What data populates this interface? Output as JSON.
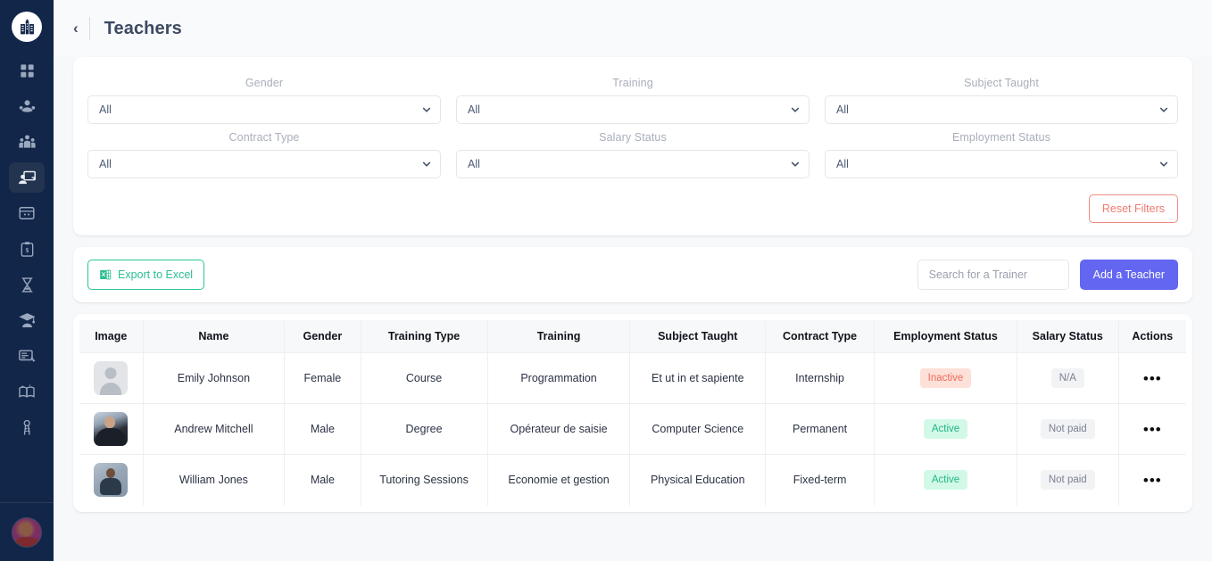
{
  "sidebar": {
    "logo": {
      "name": "school-building-logo"
    },
    "items": [
      {
        "icon": "dashboard-grid-icon",
        "name": "dashboard",
        "active": false
      },
      {
        "icon": "students-icon",
        "name": "students",
        "active": false
      },
      {
        "icon": "parents-group-icon",
        "name": "parents",
        "active": false
      },
      {
        "icon": "teacher-board-icon",
        "name": "teachers",
        "active": true
      },
      {
        "icon": "classroom-window-icon",
        "name": "classes",
        "active": false
      },
      {
        "icon": "clipboard-dollar-icon",
        "name": "payments",
        "active": false
      },
      {
        "icon": "hourglass-icon",
        "name": "schedule",
        "active": false
      },
      {
        "icon": "graduation-cap-icon",
        "name": "graduates",
        "active": false
      },
      {
        "icon": "certificate-icon",
        "name": "certificates",
        "active": false
      },
      {
        "icon": "open-book-icon",
        "name": "library",
        "active": false
      },
      {
        "icon": "keys-icon",
        "name": "access",
        "active": false
      }
    ],
    "footer": {
      "avatar_name": "user-avatar"
    }
  },
  "header": {
    "back_label": "‹",
    "title": "Teachers"
  },
  "filters": {
    "fields": [
      {
        "label": "Gender",
        "value": "All",
        "name": "gender"
      },
      {
        "label": "Training",
        "value": "All",
        "name": "training"
      },
      {
        "label": "Subject Taught",
        "value": "All",
        "name": "subject-taught"
      },
      {
        "label": "Contract Type",
        "value": "All",
        "name": "contract-type"
      },
      {
        "label": "Salary Status",
        "value": "All",
        "name": "salary-status"
      },
      {
        "label": "Employment Status",
        "value": "All",
        "name": "employment-status"
      }
    ],
    "reset_label": "Reset Filters",
    "reset_color": "#ef7b72"
  },
  "toolbar": {
    "export_label": "Export to Excel",
    "export_color": "#2bbf92",
    "search_placeholder": "Search for a Trainer",
    "search_value": "",
    "add_label": "Add a Teacher",
    "add_color": "#6366f1"
  },
  "table": {
    "columns": [
      "Image",
      "Name",
      "Gender",
      "Training Type",
      "Training",
      "Subject Taught",
      "Contract Type",
      "Employment Status",
      "Salary Status",
      "Actions"
    ],
    "rows": [
      {
        "image": "avatar-placeholder",
        "name": "Emily Johnson",
        "gender": "Female",
        "training_type": "Course",
        "training": "Programmation",
        "subject_taught": "Et ut in et sapiente",
        "contract_type": "Internship",
        "employment_status": "Inactive",
        "employment_status_kind": "inactive",
        "salary_status": "N/A",
        "salary_status_kind": "neutral",
        "actions": "•••"
      },
      {
        "image": "avatar-photo-1",
        "name": "Andrew Mitchell",
        "gender": "Male",
        "training_type": "Degree",
        "training": "Opérateur de saisie",
        "subject_taught": "Computer Science",
        "contract_type": "Permanent",
        "employment_status": "Active",
        "employment_status_kind": "active",
        "salary_status": "Not paid",
        "salary_status_kind": "neutral",
        "actions": "•••"
      },
      {
        "image": "avatar-photo-2",
        "name": "William Jones",
        "gender": "Male",
        "training_type": "Tutoring Sessions",
        "training": "Economie et gestion",
        "subject_taught": "Physical Education",
        "contract_type": "Fixed-term",
        "employment_status": "Active",
        "employment_status_kind": "active",
        "salary_status": "Not paid",
        "salary_status_kind": "neutral",
        "actions": "•••"
      }
    ]
  },
  "colors": {
    "sidebar_bg": "#12264a",
    "page_bg": "#f7f8fa",
    "accent_purple": "#6366f1",
    "accent_green": "#2bbf92",
    "accent_red": "#ef7b72",
    "badge_active_bg": "#d2f9e7",
    "badge_inactive_bg": "#fde0d8"
  }
}
